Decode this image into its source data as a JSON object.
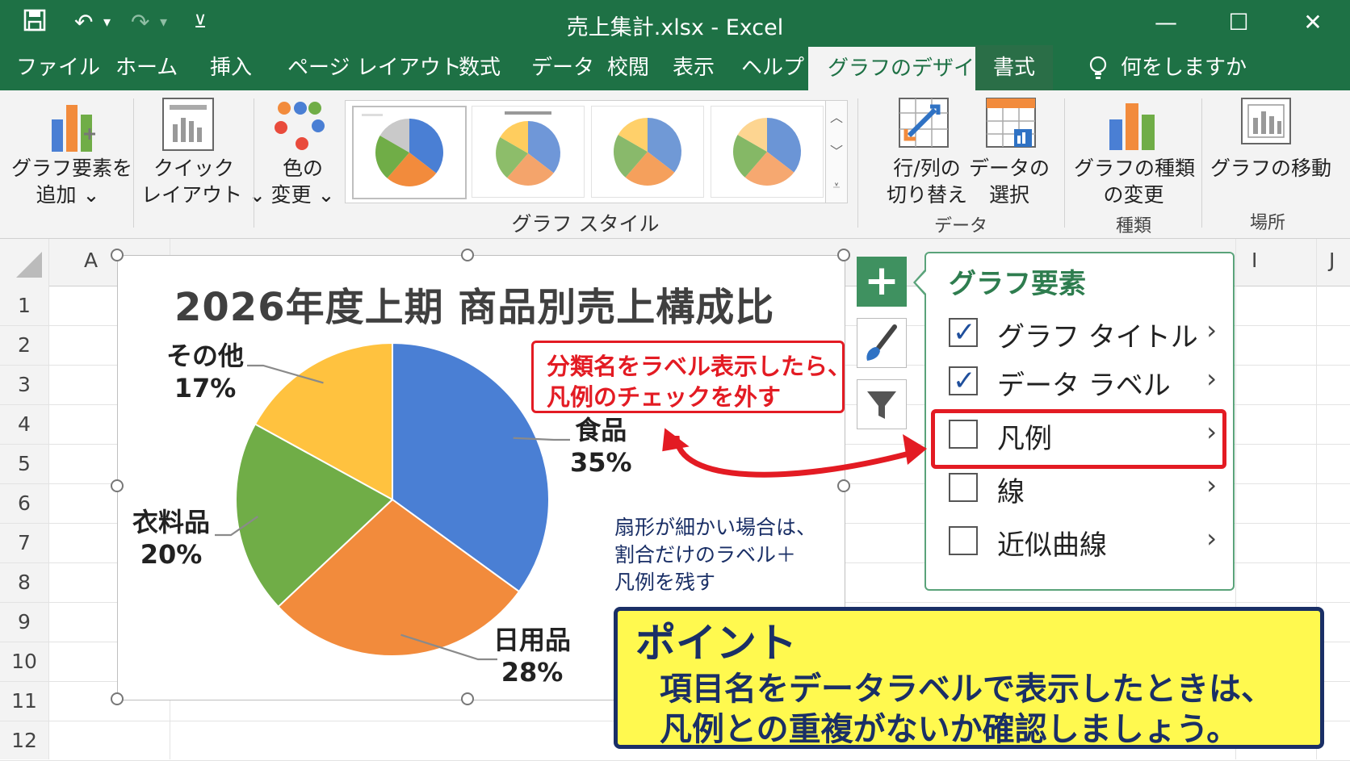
{
  "window": {
    "title": "売上集計.xlsx  -  Excel",
    "minimize_icon": "—",
    "maximize_icon": "☐",
    "close_icon": "✕"
  },
  "quick_access": {
    "save_icon": "save-icon",
    "undo_glyph": "↶",
    "redo_glyph": "↷",
    "dropdown_glyph": "▾",
    "customize_glyph": "⊻"
  },
  "tabs": [
    {
      "label": "ファイル"
    },
    {
      "label": "ホーム"
    },
    {
      "label": "挿入"
    },
    {
      "label": "ページ レイアウト"
    },
    {
      "label": "数式"
    },
    {
      "label": "データ"
    },
    {
      "label": "校閲"
    },
    {
      "label": "表示"
    },
    {
      "label": "ヘルプ"
    },
    {
      "label": "グラフのデザイン"
    },
    {
      "label": "書式"
    }
  ],
  "tell_me": "何をしますか",
  "ribbon": {
    "add_element": {
      "line1": "グラフ要素を",
      "line2": "追加 ⌄"
    },
    "quick_layout": {
      "line1": "クイック",
      "line2": "レイアウト ⌄"
    },
    "change_color": {
      "line1": "色の",
      "line2": "変更 ⌄"
    },
    "styles_group_label": "グラフ スタイル",
    "switch_row_col": {
      "line1": "行/列の",
      "line2": "切り替え"
    },
    "select_data": {
      "line1": "データの",
      "line2": "選択"
    },
    "data_group_label": "データ",
    "change_type": {
      "line1": "グラフの種類",
      "line2": "の変更"
    },
    "type_group_label": "種類",
    "move_chart": {
      "line1": "グラフの移動"
    },
    "location_group_label": "場所",
    "scroll_up": "︿",
    "scroll_down": "﹀",
    "scroll_more": "⩡"
  },
  "sheet": {
    "columns": [
      "A",
      "I",
      "J"
    ],
    "rows": [
      "1",
      "2",
      "3",
      "4",
      "5",
      "6",
      "7",
      "8",
      "9",
      "10",
      "11",
      "12"
    ]
  },
  "colors": {
    "excel_green": "#1e7145",
    "food": "#4a7fd4",
    "daily": "#f28b3c",
    "clothing": "#70ad47",
    "other": "#ffc23f",
    "highlight_red": "#e31b23",
    "point_yellow": "#fff94f",
    "point_navy": "#1a2f66"
  },
  "chart_data": {
    "type": "pie",
    "title": "2026年度上期 商品別売上構成比",
    "categories": [
      "食品",
      "日用品",
      "衣料品",
      "その他"
    ],
    "values": [
      35,
      28,
      20,
      17
    ],
    "value_labels": [
      "35%",
      "28%",
      "20%",
      "17%"
    ],
    "colors": [
      "#4a7fd4",
      "#f28b3c",
      "#70ad47",
      "#ffc23f"
    ],
    "legend": "none",
    "data_labels": "category name + percentage, outside end with leader lines"
  },
  "chart_tip": {
    "line1": "扇形が細かい場合は、",
    "line2": "割合だけのラベル＋",
    "line3": "凡例を残す"
  },
  "side_buttons": {
    "plus": "+",
    "styles": "brush-icon",
    "filter": "filter-icon"
  },
  "chart_elements_panel": {
    "title": "グラフ要素",
    "items": [
      {
        "label": "グラフ タイトル",
        "checked": true
      },
      {
        "label": "データ ラベル",
        "checked": true
      },
      {
        "label": "凡例",
        "checked": false
      },
      {
        "label": "線",
        "checked": false
      },
      {
        "label": "近似曲線",
        "checked": false
      }
    ],
    "arrow": "›",
    "check_glyph": "✓"
  },
  "callout": {
    "line1": "分類名をラベル表示したら、",
    "line2": "凡例のチェックを外す"
  },
  "point": {
    "heading": "ポイント",
    "line1": "項目名をデータラベルで表示したときは、",
    "line2": "凡例との重複がないか確認しましょう。"
  }
}
